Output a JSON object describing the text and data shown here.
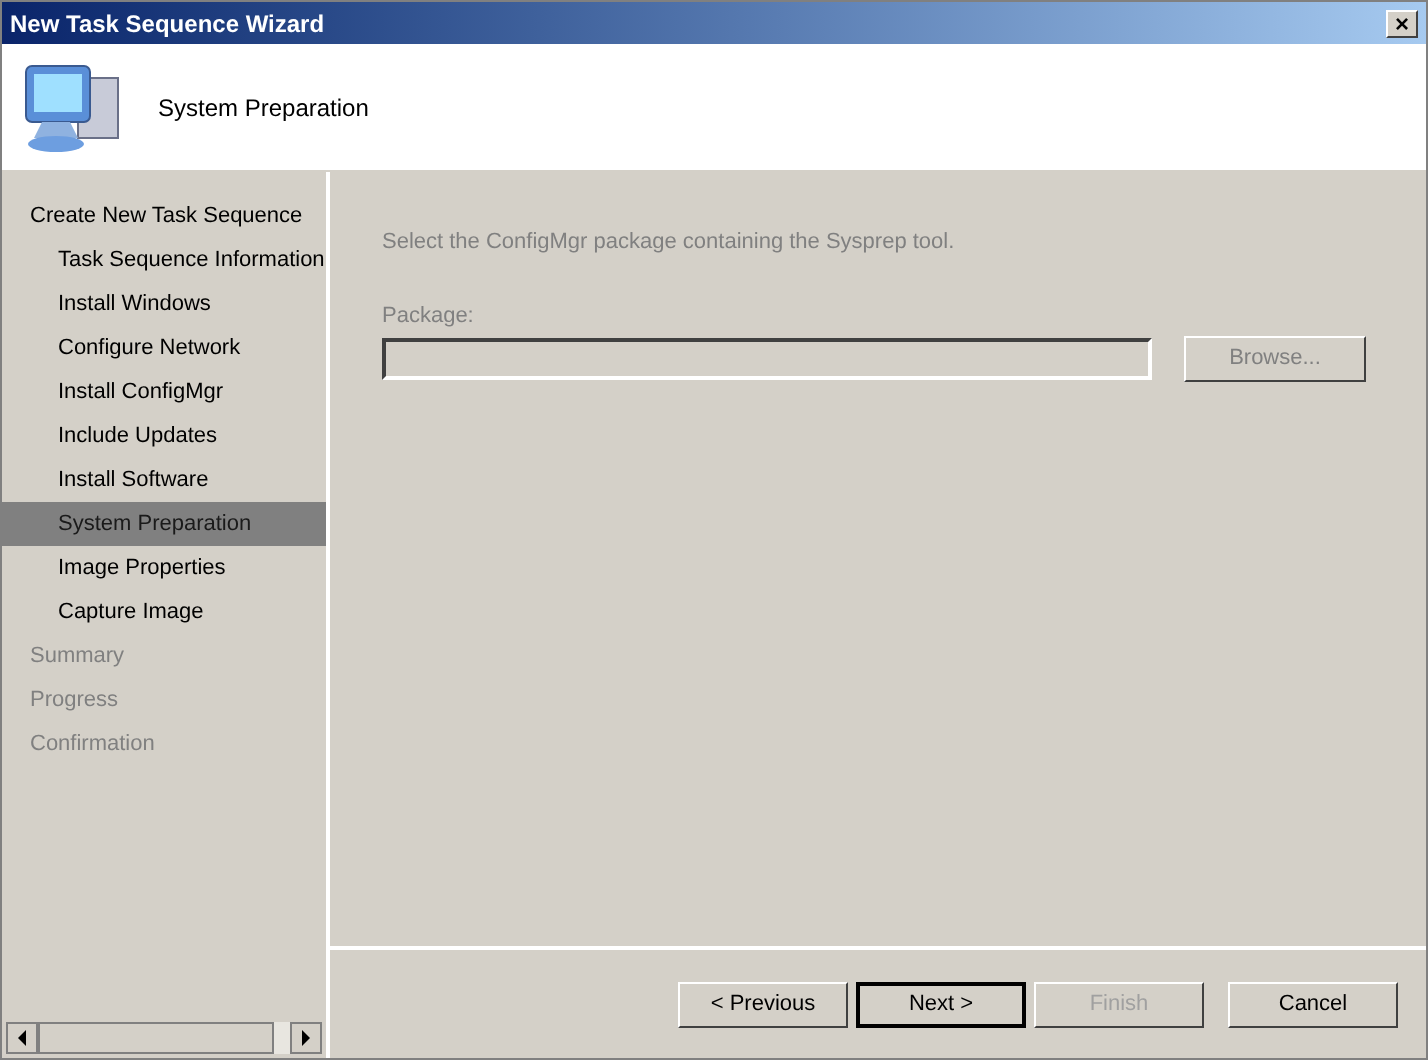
{
  "window": {
    "title": "New Task Sequence Wizard",
    "close": "×"
  },
  "header": {
    "title": "System Preparation"
  },
  "sidebar": {
    "items": [
      {
        "label": "Create New Task Sequence",
        "selected": false,
        "disabled": false,
        "children": [
          {
            "label": "Task Sequence Information",
            "selected": false,
            "disabled": false
          },
          {
            "label": "Install Windows",
            "selected": false,
            "disabled": false
          },
          {
            "label": "Configure Network",
            "selected": false,
            "disabled": false
          },
          {
            "label": "Install ConfigMgr",
            "selected": false,
            "disabled": false
          },
          {
            "label": "Include Updates",
            "selected": false,
            "disabled": false
          },
          {
            "label": "Install Software",
            "selected": false,
            "disabled": false
          },
          {
            "label": "System Preparation",
            "selected": true,
            "disabled": false
          },
          {
            "label": "Image Properties",
            "selected": false,
            "disabled": false
          },
          {
            "label": "Capture Image",
            "selected": false,
            "disabled": false
          }
        ]
      },
      {
        "label": "Summary",
        "selected": false,
        "disabled": true
      },
      {
        "label": "Progress",
        "selected": false,
        "disabled": true
      },
      {
        "label": "Confirmation",
        "selected": false,
        "disabled": true
      }
    ]
  },
  "content": {
    "instruction": "Select the ConfigMgr package containing the Sysprep tool.",
    "package_label": "Package:",
    "browse_button": {
      "label": "Browse...",
      "disabled": true
    }
  },
  "buttons": [
    {
      "label": "< Previous",
      "disabled": false,
      "default": false
    },
    {
      "label": "Next >",
      "disabled": false,
      "default": true
    },
    {
      "label": "Finish",
      "disabled": true,
      "default": false
    },
    {
      "label": "Cancel",
      "disabled": false,
      "default": false
    }
  ]
}
